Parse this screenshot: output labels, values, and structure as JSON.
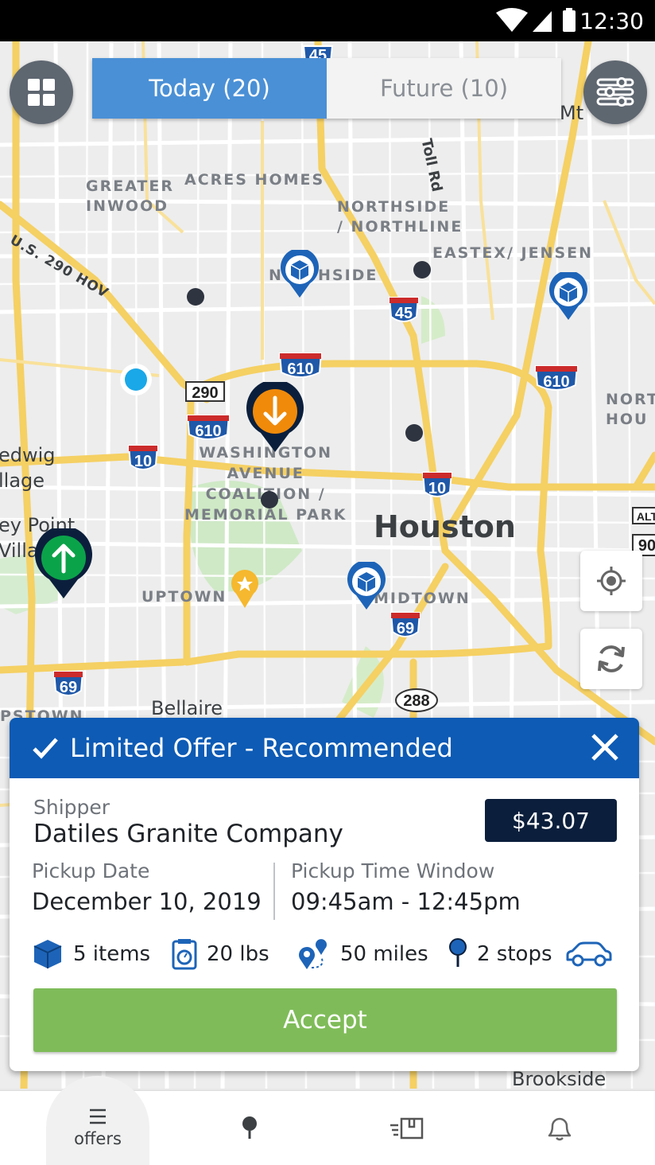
{
  "status_bar": {
    "time": "12:30"
  },
  "tabs": {
    "today": "Today (20)",
    "future": "Future (10)"
  },
  "map": {
    "labels": {
      "greater_inwood": "GREATER\nINWOOD",
      "acres_homes": "ACRES HOMES",
      "northside": "NORTHSIDE\n/ NORTHLINE",
      "eastex": "EASTEX/ JENSEN",
      "houston": "Houston",
      "washington": "WASHINGTON\nAVENUE\nCOALITION /\nMEMORIAL PARK",
      "uptown": "UPTOWN",
      "midtown": "MIDTOWN",
      "bellaire": "Bellaire",
      "brookside": "Brookside",
      "us290": "U.S. 290 HOV",
      "toll_rd": "Toll Rd",
      "hsid": "HSIDE",
      "nside_n": "N",
      "mt": "Mt",
      "nort": "NORT\nHOU",
      "edwig": "edwig\nllage",
      "ey_point": "ey Point\nVilla",
      "pstown": "PSTOWN"
    },
    "shields": [
      "45",
      "45",
      "610",
      "610",
      "610",
      "290",
      "10",
      "10",
      "69",
      "69",
      "288",
      "90",
      "ALT"
    ]
  },
  "offer": {
    "header": "Limited  Offer - Recommended",
    "shipper_label": "Shipper",
    "shipper_name": "Datiles Granite Company",
    "price": "$43.07",
    "pickup_date_label": "Pickup Date",
    "pickup_date": "December  10, 2019",
    "pickup_window_label": "Pickup Time Window",
    "pickup_window": "09:45am - 12:45pm",
    "items": "5 items",
    "weight": "20 lbs",
    "distance": "50 miles",
    "stops": "2 stops",
    "accept": "Accept"
  },
  "nav": {
    "offers": "offers"
  },
  "colors": {
    "primary": "#0d5bb5",
    "tab_active": "#4a90d6",
    "accept": "#7fbc59",
    "price_bg": "#0b1f3c",
    "pickup_pin": "#0ba34a",
    "drop_pin": "#f08a0a"
  },
  "icons": [
    "grid-icon",
    "filter-sliders-icon",
    "locate-icon",
    "refresh-icon",
    "check-icon",
    "close-icon",
    "package-icon",
    "scale-icon",
    "route-icon",
    "stop-pin-icon",
    "car-icon",
    "menu-icon",
    "pin-icon",
    "delivery-icon",
    "bell-icon",
    "wifi-icon",
    "signal-icon",
    "battery-icon"
  ]
}
